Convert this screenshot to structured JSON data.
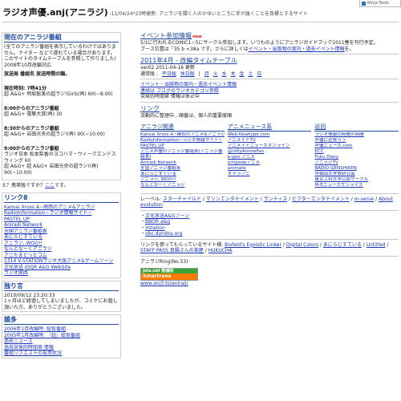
{
  "tools": {
    "label": "Ninja Tools"
  },
  "header": {
    "title": "ラジオ声優.anj(アニラジ)",
    "subtitle": ":11/04/24*23時更新: アニラジを聞く人のかゆいところに手が届くことを目標とするサイト"
  },
  "left": {
    "now": {
      "title": "現在のアニラジ番組",
      "desc": "(全てのアニラジ番組を表示しているわけではありません。ナイター などで遅れている場合があります。このサイトのタイムテーブルを参照して作りました) 2008年10月改編対応",
      "desc2": "放送局 番組名 放送時間の順。",
      "time7": "現在時刻: 7時41分",
      "prog7": "超 A&G+ 明坂聡美の超ラジ!Girls(再) 60(~8:00)",
      "h800": "8:00からのアニラジ番組",
      "p800": "超 A&G+ 電撃大賞(再) 30",
      "h830": "8:30からのアニラジ番組",
      "p830": "超 A&G+ 岩田光央の超ラジ!(再) 90(~10:00)",
      "h900": "9:00からのアニラジ番組",
      "p900a": "ラジオ日本 松本梨香のヨコハマ・ウィークエンドスウィング 60",
      "p900b": "超 A&G+ 超 A&G+ 岩田光央の超ラジ!(再) 90(~10:00)",
      "q": "え？携帯版ですか？",
      "q_link": "ここ",
      "q_end": "です。"
    },
    "links": {
      "title": "リンク8",
      "items": [
        "Kansai Xross A~関西のアニメ&アニラジ",
        "RadioInformation~ラジオ情報サイト~",
        "PASTEL UP",
        "Aniradi Network",
        "全国アニラジ番組表",
        "あにらじすている",
        "アニラジ, WOO!!",
        "なんとなーくアニラジ",
        "アニたまどっとコム",
        "1314 V-STATIONラジオ大阪アニメ&ゲームゾーン",
        "文化放送 JOQR A&G WebSite",
        "ラジオ関西"
      ]
    },
    "about": {
      "title": "独り言",
      "date": "2010/09/12 23:20:33",
      "text": "1ヶ月ほど経過してしまいましたが、コミケにお越し頂いた方、ありがとうございました。"
    },
    "misc": {
      "title": "雑多",
      "items": [
        "2006年1月改編時: 総覧番組",
        "2005年1月改編時: 「超」総覧番組",
        "過去ニュース",
        "過去突発的時間帯 情報",
        "番組リクエストの投票状況"
      ]
    }
  },
  "right": {
    "event": {
      "title": "イベント参加情報",
      "new": "new",
      "text1": "5/1に行われるCOMIC1☆5にサークル参加します。いつものようにアニラジガイドブック2011春を刊行予定。",
      "text2": "ブース位置は「35 b <38a です。さらに詳しくは",
      "text2_link": "イベント・出版物の案内・過去イベント情報",
      "text2_end": "を。"
    },
    "timetable": {
      "title": "2011年4月 - 改編タイムテーブル",
      "version": "ver02 2011-04-16 更新",
      "label": "通常版 : ",
      "weekday": "平日版",
      "holiday": "休日版",
      "days": [
        "月",
        "火",
        "水",
        "木",
        "金",
        "土",
        "日"
      ]
    },
    "notes": {
      "line1": "イベント・出版物の案内・過去イベント情報",
      "line2": "連続は ブログのラジオカテゴリ参照",
      "line3": "突発的時間帯 情報は休止中"
    },
    "links": {
      "title": "リンク",
      "text": "流動的に整理中…順番は、個人的重要度順"
    },
    "cols": [
      {
        "title": "アニラジ関連",
        "items": [
          "Kansai Xross A~関西のアニメ&アニラジ",
          "RadioInformation~ラジオ情報サイト~",
          "PASTEL UP",
          "アニメ声優のアニラジ番組表(アニラジ番組表)",
          "Aniradi Network",
          "全国アニラジ番組表",
          "あにらじすている",
          "アニラジ, WOO!!",
          "なんとなーくアニラジ"
        ]
      },
      {
        "title": "アニメニュース系",
        "items": [
          "Web-Newtype.com",
          "アニメイトTV",
          "アニメイトニュースオンライン",
          "@niftyAnimeFan",
          "e-goo アニメ",
          "ichipedeアニメ",
          "animate",
          "キャラアニ"
        ]
      },
      {
        "title": "巡回",
        "items": [
          "ラジオ情報の時間の時間",
          "声優に近寄ろう",
          "声優ニュース.com",
          "ECC",
          "Fuku Diary",
          "アニラジTV",
          "RADIO GENSHIKEN",
          "早稲田大学放研究会",
          "東京工科大学公認サークル",
          "M-Eニュースサンライズ"
        ]
      }
    ],
    "labels": {
      "prefix": "レーベル: ",
      "items": [
        "スターチャイルド",
        "マリンエンタテイメント",
        "ランティス",
        "ビクターエンタテイメント",
        "m-serve",
        "About evolution"
      ]
    },
    "bullets": [
      "文化放送A&Gゾーン",
      "BBOR a&g",
      "Vstation",
      "obc.dyndns.org"
    ],
    "refs": {
      "text": "リンクを張ってもらっているサイト様: ",
      "items": [
        "Biofeld's Egoistic Linker",
        "Digital Colors",
        "あにらじすている",
        "Untitled",
        "STAFF PASS 真鍋さんの楽屋",
        "HUKUCHA"
      ]
    },
    "ring": "アニラジRing(No.53)",
    "rss": {
      "b1": "jsta.net 勢議院",
      "b2": "Smartrans"
    },
    "url": "www.anj3.to/aniraji/"
  }
}
